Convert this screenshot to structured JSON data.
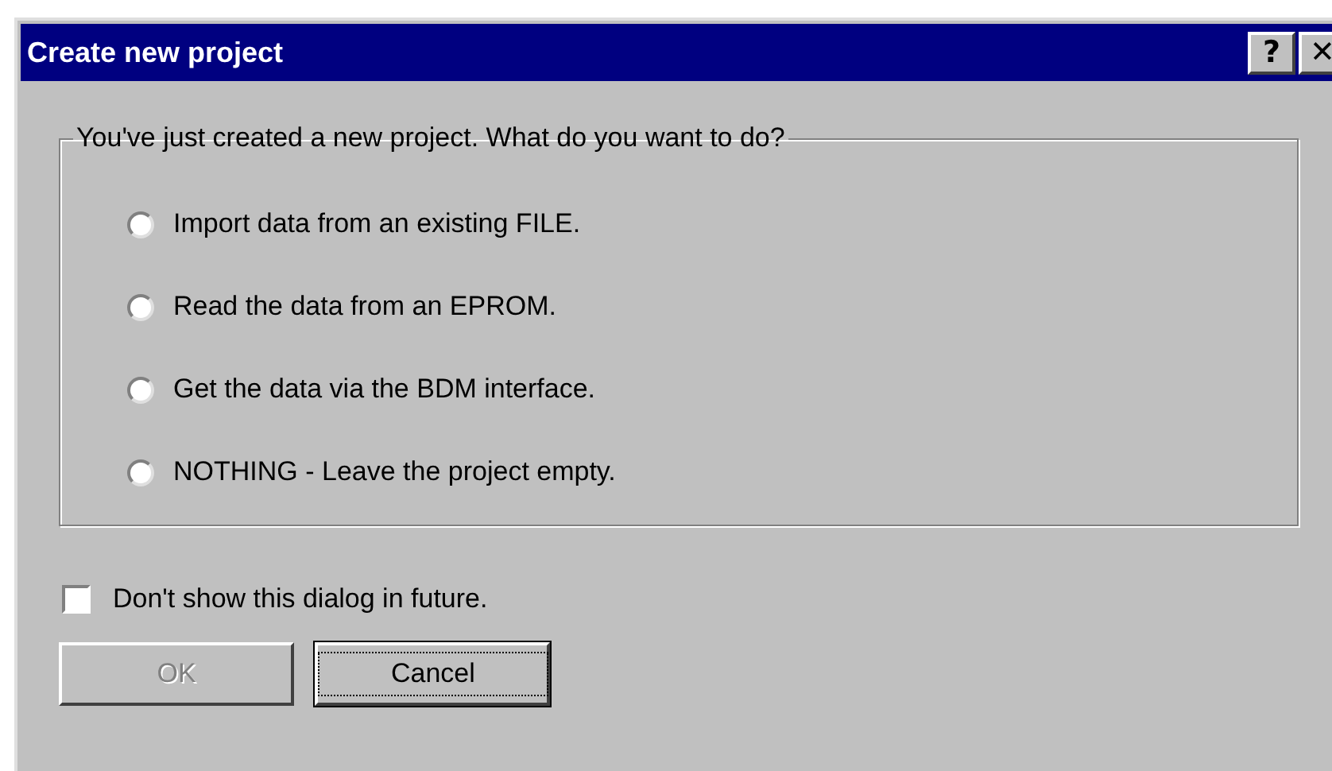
{
  "window": {
    "title": "Create new project",
    "title_buttons": [
      {
        "kind": "help",
        "label": "?"
      },
      {
        "kind": "close",
        "label": "✕"
      }
    ]
  },
  "group": {
    "caption": "You've just created a new project. What do you want to do?",
    "options": [
      {
        "label": "Import data from an existing FILE.",
        "selected": false
      },
      {
        "label": "Read the data from an EPROM.",
        "selected": false
      },
      {
        "label": "Get the data via the BDM interface.",
        "selected": false
      },
      {
        "label": "NOTHING - Leave the project empty.",
        "selected": false
      }
    ]
  },
  "checkbox": {
    "label": "Don't show this dialog in future.",
    "checked": false
  },
  "buttons": [
    {
      "label": "OK",
      "disabled": true,
      "focused": false
    },
    {
      "label": "Cancel",
      "disabled": false,
      "focused": true
    }
  ]
}
